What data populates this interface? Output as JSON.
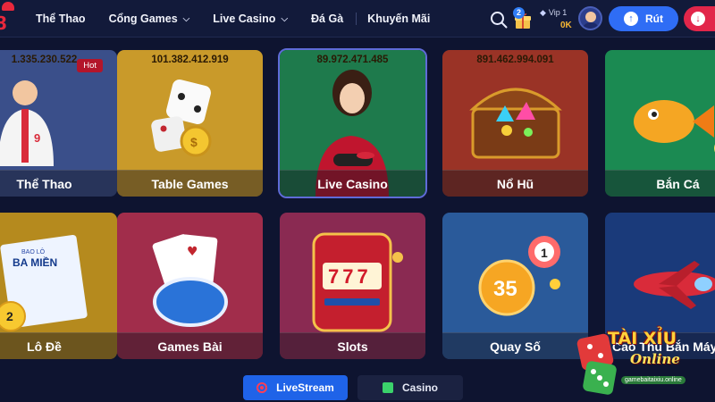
{
  "header": {
    "logo_text": "8",
    "nav": [
      {
        "label": "Thể Thao",
        "has_dropdown": false
      },
      {
        "label": "Cổng Games",
        "has_dropdown": true
      },
      {
        "label": "Live Casino",
        "has_dropdown": true
      },
      {
        "label": "Đá Gà",
        "has_dropdown": false
      },
      {
        "label": "Khuyến Mãi",
        "has_dropdown": false
      }
    ],
    "gift_count": "2",
    "vip_label": "Vip 1",
    "balance": "0K",
    "withdraw_label": "Rút",
    "colors": {
      "withdraw": "#2f6df5",
      "deposit": "#e2264a",
      "brand": "#e8283c"
    }
  },
  "games": [
    {
      "label": "Thể Thao",
      "jackpot": "1.335.230.522",
      "badge": "Hot",
      "theme": "#3a4f8a"
    },
    {
      "label": "Table Games",
      "jackpot": "101.382.412.919",
      "badge": "",
      "theme": "#c99a2a"
    },
    {
      "label": "Live Casino",
      "jackpot": "89.972.471.485",
      "badge": "",
      "theme": "#1e7a4c"
    },
    {
      "label": "Nổ Hũ",
      "jackpot": "891.462.994.091",
      "badge": "",
      "theme": "#9a3326"
    },
    {
      "label": "Bắn Cá",
      "jackpot": "",
      "badge": "",
      "theme": "#1b8a52"
    },
    {
      "label": "Lô Đề",
      "jackpot": "",
      "badge": "",
      "theme": "#b58a1e"
    },
    {
      "label": "Games Bài",
      "jackpot": "",
      "badge": "",
      "theme": "#a12d4b"
    },
    {
      "label": "Slots",
      "jackpot": "",
      "badge": "",
      "theme": "#8a2a52"
    },
    {
      "label": "Quay Số",
      "jackpot": "",
      "badge": "",
      "theme": "#2a5a9a"
    },
    {
      "label": "Cao Thủ Bắn Máy Bay",
      "jackpot": "",
      "badge": "",
      "theme": "#1a3a7a"
    }
  ],
  "grid_card_art": {
    "ball_tag": "BAO LÔ",
    "board_title": "BA MIỀN",
    "slot_digits": "777",
    "lotto_ball": "35",
    "lotto_ball_small": "1",
    "jersey_number": "9",
    "chip_number": "2"
  },
  "bottom_tabs": [
    {
      "label": "LiveStream",
      "active": true
    },
    {
      "label": "Casino",
      "active": false
    }
  ],
  "watermark": {
    "title": "TÀI XỈU",
    "subtitle": "Online",
    "url": "gamebaitaixiu.online"
  }
}
